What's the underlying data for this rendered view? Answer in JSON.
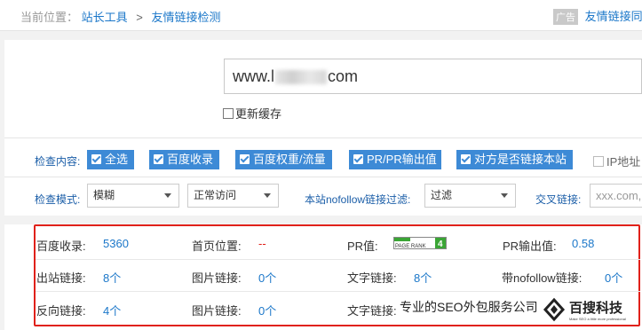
{
  "breadcrumb": {
    "prefix": "当前位置：",
    "home": "站长工具",
    "separator": ">",
    "current": "友情链接检测"
  },
  "ad": {
    "tag": "广告",
    "link": "友情链接同"
  },
  "url_input": {
    "value_start": "www.l",
    "value_end": "com"
  },
  "refresh_cache": {
    "label": "更新缓存",
    "checked": false
  },
  "check_content": {
    "label": "检查内容:",
    "items": [
      {
        "label": "全选",
        "checked": true
      },
      {
        "label": "百度收录",
        "checked": true
      },
      {
        "label": "百度权重/流量",
        "checked": true
      },
      {
        "label": "PR/PR输出值",
        "checked": true
      },
      {
        "label": "对方是否链接本站",
        "checked": true
      }
    ],
    "ip": {
      "label": "IP地址",
      "checked": false
    }
  },
  "check_mode": {
    "label": "检查模式:",
    "mode_select": "模糊",
    "access_select": "正常访问",
    "nofollow_label": "本站nofollow链接过滤:",
    "nofollow_select": "过滤",
    "cross_label": "交叉链接:",
    "cross_placeholder": "xxx.com,"
  },
  "results": {
    "rows": [
      [
        {
          "key": "百度收录:",
          "value": "5360"
        },
        {
          "key": "首页位置:",
          "value": "--"
        },
        {
          "key": "PR值:",
          "value": "PAGE RANK 4"
        },
        {
          "key": "PR输出值:",
          "value": "0.58"
        }
      ],
      [
        {
          "key": "出站链接:",
          "value": "8个"
        },
        {
          "key": "图片链接:",
          "value": "0个"
        },
        {
          "key": "文字链接:",
          "value": "8个"
        },
        {
          "key": "带nofollow链接:",
          "value": "0个"
        }
      ],
      [
        {
          "key": "反向链接:",
          "value": "4个"
        },
        {
          "key": "图片链接:",
          "value": "0个"
        },
        {
          "key": "文字链接:",
          "value": ""
        }
      ]
    ],
    "pr_badge": {
      "text": "PAGE RANK",
      "rank": "4",
      "bar_fraction": 0.4
    }
  },
  "watermark": {
    "text": "专业的SEO外包服务公司",
    "logo_text": "百搜科技",
    "logo_sub": "Make SEO a little more professional"
  },
  "colors": {
    "accent": "#3d8ad6",
    "link": "#1b77c9",
    "highlight_border": "#e0211a"
  }
}
